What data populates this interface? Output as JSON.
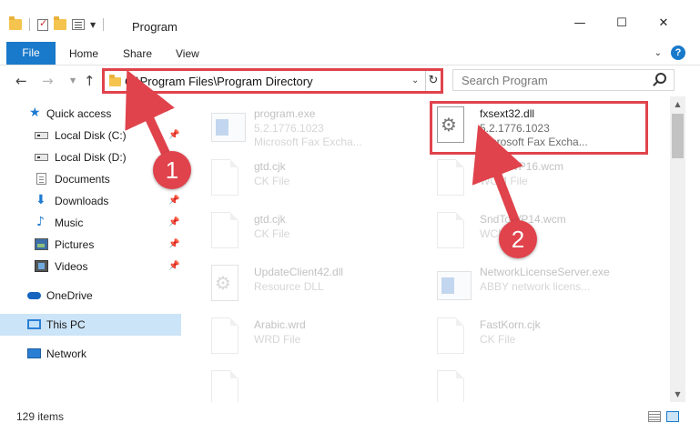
{
  "window": {
    "title": "Program",
    "minimize": "—",
    "maximize": "☐",
    "close": "✕"
  },
  "ribbon": {
    "tabs": [
      "File",
      "Home",
      "Share",
      "View"
    ],
    "help": "?"
  },
  "nav": {
    "back": "←",
    "forward": "→",
    "up": "↑",
    "address": "C:\\Program Files\\Program Directory",
    "search_placeholder": "Search Program"
  },
  "sidebar": {
    "items": [
      {
        "label": "Quick access",
        "icon": "star-icon"
      },
      {
        "label": "Local Disk (C:)",
        "icon": "disk-icon"
      },
      {
        "label": "Local Disk (D:)",
        "icon": "disk-icon"
      },
      {
        "label": "Documents",
        "icon": "documents-icon"
      },
      {
        "label": "Downloads",
        "icon": "download-icon"
      },
      {
        "label": "Music",
        "icon": "music-icon"
      },
      {
        "label": "Pictures",
        "icon": "pictures-icon"
      },
      {
        "label": "Videos",
        "icon": "videos-icon"
      },
      {
        "label": "OneDrive",
        "icon": "cloud-icon"
      },
      {
        "label": "This PC",
        "icon": "computer-icon"
      },
      {
        "label": "Network",
        "icon": "network-icon"
      }
    ]
  },
  "files": [
    {
      "name": "program.exe",
      "sub1": "5.2.1776.1023",
      "sub2": "Microsoft Fax Excha..."
    },
    {
      "name": "fxsext32.dll",
      "sub1": "5.2.1776.1023",
      "sub2": "Microsoft Fax Excha..."
    },
    {
      "name": "gtd.cjk",
      "sub1": "CK File",
      "sub2": ""
    },
    {
      "name": "StodoWP16.wcm",
      "sub1": "WCM File",
      "sub2": ""
    },
    {
      "name": "gtd.cjk",
      "sub1": "CK File",
      "sub2": ""
    },
    {
      "name": "SndToWP14.wcm",
      "sub1": "WCM File",
      "sub2": ""
    },
    {
      "name": "UpdateClient42.dll",
      "sub1": "Resource DLL",
      "sub2": ""
    },
    {
      "name": "NetworkLicenseServer.exe",
      "sub1": "ABBY network licens...",
      "sub2": ""
    },
    {
      "name": "Arabic.wrd",
      "sub1": "WRD File",
      "sub2": ""
    },
    {
      "name": "FastKorn.cjk",
      "sub1": "CK File",
      "sub2": ""
    }
  ],
  "callouts": [
    "1",
    "2"
  ],
  "status": {
    "item_count": "129 items"
  },
  "colors": {
    "accent": "#1979ca",
    "highlight_red": "#e0434c",
    "selection": "#cce4f7"
  }
}
